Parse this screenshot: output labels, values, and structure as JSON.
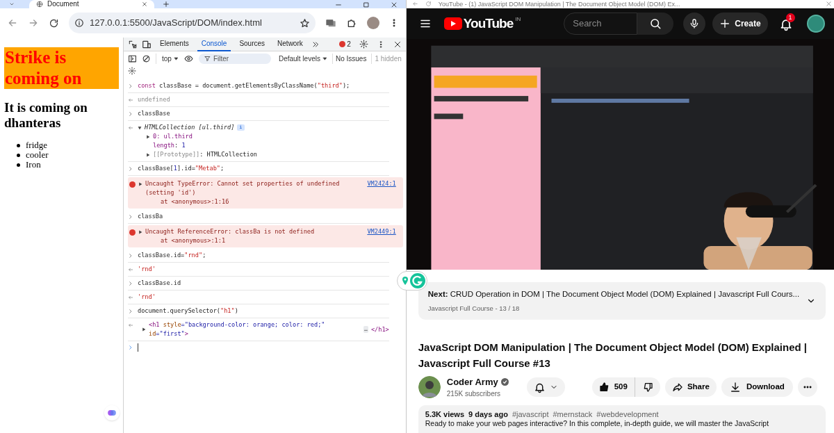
{
  "left_window": {
    "tab_title": "Document",
    "url": "127.0.0.1:5500/JavaScript/DOM/index.html"
  },
  "page": {
    "heading": "Strike is coming on",
    "subheading": "It is coming on dhanteras",
    "items": [
      "fridge",
      "cooler",
      "Iron"
    ]
  },
  "devtools": {
    "tabs": [
      {
        "label": "Elements",
        "selected": false
      },
      {
        "label": "Console",
        "selected": true
      },
      {
        "label": "Sources",
        "selected": false
      },
      {
        "label": "Network",
        "selected": false
      }
    ],
    "error_count": "2",
    "context": "top",
    "filter_placeholder": "Filter",
    "levels": "Default levels",
    "issues": "No Issues",
    "hidden": "1 hidden"
  },
  "console": [
    {
      "kind": "input",
      "parts": [
        {
          "text": "const",
          "kind": "keyword"
        },
        {
          "text": " classBase = document.getElementsByClassName(",
          "kind": "plain"
        },
        {
          "text": "\"third\"",
          "kind": "string"
        },
        {
          "text": ");",
          "kind": "plain"
        }
      ]
    },
    {
      "kind": "result",
      "parts": [
        {
          "text": "undefined",
          "kind": "muted"
        }
      ]
    },
    {
      "kind": "input",
      "parts": [
        {
          "text": "classBase",
          "kind": "plain"
        }
      ]
    },
    {
      "kind": "tree",
      "expanded": true,
      "parts": [
        {
          "text": "HTMLCollection [ul.third]",
          "kind": "italic"
        }
      ],
      "badge": "i",
      "children": [
        {
          "expandable": true,
          "parts": [
            {
              "text": "0",
              "kind": "prop"
            },
            {
              "text": ": ul.third",
              "kind": "prop"
            }
          ]
        },
        {
          "expandable": false,
          "parts": [
            {
              "text": "length",
              "kind": "prop"
            },
            {
              "text": ": ",
              "kind": "plain"
            },
            {
              "text": "1",
              "kind": "number"
            }
          ]
        },
        {
          "expandable": true,
          "parts": [
            {
              "text": "[[Prototype]]",
              "kind": "muted"
            },
            {
              "text": ": HTMLCollection",
              "kind": "plain"
            }
          ]
        }
      ]
    },
    {
      "kind": "input",
      "parts": [
        {
          "text": "classBase[",
          "kind": "plain"
        },
        {
          "text": "1",
          "kind": "number"
        },
        {
          "text": "].id=",
          "kind": "plain"
        },
        {
          "text": "\"Metab\"",
          "kind": "string"
        },
        {
          "text": ";",
          "kind": "plain"
        }
      ]
    },
    {
      "kind": "error",
      "message": "Uncaught TypeError: Cannot set properties of undefined (setting 'id')",
      "trace": "at <anonymous>:1:16",
      "source": "VM2424:1"
    },
    {
      "kind": "input",
      "parts": [
        {
          "text": "classBa",
          "kind": "plain"
        }
      ]
    },
    {
      "kind": "error",
      "message": "Uncaught ReferenceError: classBa is not defined",
      "trace": "at <anonymous>:1:1",
      "source": "VM2449:1"
    },
    {
      "kind": "input",
      "parts": [
        {
          "text": "classBase.id=",
          "kind": "plain"
        },
        {
          "text": "\"rnd\"",
          "kind": "string"
        },
        {
          "text": ";",
          "kind": "plain"
        }
      ]
    },
    {
      "kind": "result",
      "parts": [
        {
          "text": "'rnd'",
          "kind": "string"
        }
      ]
    },
    {
      "kind": "input",
      "parts": [
        {
          "text": "classBase.id",
          "kind": "plain"
        }
      ]
    },
    {
      "kind": "result",
      "parts": [
        {
          "text": "'rnd'",
          "kind": "string"
        }
      ]
    },
    {
      "kind": "input",
      "parts": [
        {
          "text": "document.querySelector(",
          "kind": "plain"
        },
        {
          "text": "\"h1\"",
          "kind": "string"
        },
        {
          "text": ")",
          "kind": "plain"
        }
      ]
    },
    {
      "kind": "element",
      "parts": [
        {
          "text": "<h1 ",
          "kind": "tag"
        },
        {
          "text": "style",
          "kind": "attr"
        },
        {
          "text": "=\"background-color: orange; color: red;\" ",
          "kind": "value"
        },
        {
          "text": "id",
          "kind": "attr"
        },
        {
          "text": "=\"first\"",
          "kind": "value"
        },
        {
          "text": ">",
          "kind": "tag"
        }
      ],
      "ellipsis": "…",
      "closing": "</h1>"
    },
    {
      "kind": "prompt"
    }
  ],
  "right_window": {
    "tab_title": "YouTube - (1) JavaScript DOM Manipulation | The Document Object Model (DOM) Ex..."
  },
  "youtube": {
    "logo": "YouTube",
    "region": "IN",
    "search_placeholder": "Search",
    "create": "Create",
    "notifications": "1",
    "video": {
      "kind": "picture"
    },
    "next": {
      "label": "Next:",
      "title": "CRUD Operation in DOM | The Document Object Model (DOM) Explained | Javascript Full Cours...",
      "playlist": "Javascript Full Course - 13 / 18"
    },
    "title": "JavaScript DOM Manipulation | The Document Object Model (DOM) Explained | Javascript Full Course #13",
    "channel": "Coder Army",
    "verified": true,
    "subscribers": "215K subscribers",
    "likes": "509",
    "share": "Share",
    "download": "Download",
    "views": "5.3K views",
    "age": "9 days ago",
    "hashtags": [
      "#javascript",
      "#mernstack",
      "#webdevelopment"
    ],
    "description": "Ready to make your web pages interactive? In this complete, in-depth guide, we will master the JavaScript"
  }
}
